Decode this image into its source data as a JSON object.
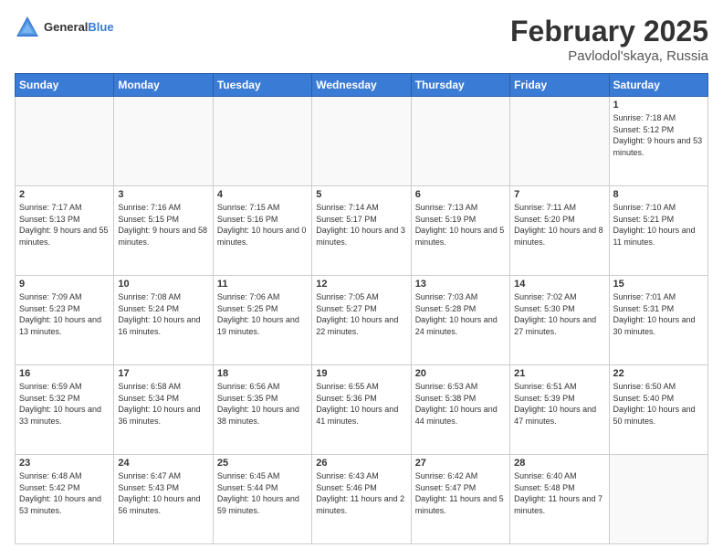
{
  "header": {
    "logo_general": "General",
    "logo_blue": "Blue",
    "month_title": "February 2025",
    "location": "Pavlodol'skaya, Russia"
  },
  "weekdays": [
    "Sunday",
    "Monday",
    "Tuesday",
    "Wednesday",
    "Thursday",
    "Friday",
    "Saturday"
  ],
  "weeks": [
    [
      {
        "day": "",
        "info": ""
      },
      {
        "day": "",
        "info": ""
      },
      {
        "day": "",
        "info": ""
      },
      {
        "day": "",
        "info": ""
      },
      {
        "day": "",
        "info": ""
      },
      {
        "day": "",
        "info": ""
      },
      {
        "day": "1",
        "info": "Sunrise: 7:18 AM\nSunset: 5:12 PM\nDaylight: 9 hours and 53 minutes."
      }
    ],
    [
      {
        "day": "2",
        "info": "Sunrise: 7:17 AM\nSunset: 5:13 PM\nDaylight: 9 hours and 55 minutes."
      },
      {
        "day": "3",
        "info": "Sunrise: 7:16 AM\nSunset: 5:15 PM\nDaylight: 9 hours and 58 minutes."
      },
      {
        "day": "4",
        "info": "Sunrise: 7:15 AM\nSunset: 5:16 PM\nDaylight: 10 hours and 0 minutes."
      },
      {
        "day": "5",
        "info": "Sunrise: 7:14 AM\nSunset: 5:17 PM\nDaylight: 10 hours and 3 minutes."
      },
      {
        "day": "6",
        "info": "Sunrise: 7:13 AM\nSunset: 5:19 PM\nDaylight: 10 hours and 5 minutes."
      },
      {
        "day": "7",
        "info": "Sunrise: 7:11 AM\nSunset: 5:20 PM\nDaylight: 10 hours and 8 minutes."
      },
      {
        "day": "8",
        "info": "Sunrise: 7:10 AM\nSunset: 5:21 PM\nDaylight: 10 hours and 11 minutes."
      }
    ],
    [
      {
        "day": "9",
        "info": "Sunrise: 7:09 AM\nSunset: 5:23 PM\nDaylight: 10 hours and 13 minutes."
      },
      {
        "day": "10",
        "info": "Sunrise: 7:08 AM\nSunset: 5:24 PM\nDaylight: 10 hours and 16 minutes."
      },
      {
        "day": "11",
        "info": "Sunrise: 7:06 AM\nSunset: 5:25 PM\nDaylight: 10 hours and 19 minutes."
      },
      {
        "day": "12",
        "info": "Sunrise: 7:05 AM\nSunset: 5:27 PM\nDaylight: 10 hours and 22 minutes."
      },
      {
        "day": "13",
        "info": "Sunrise: 7:03 AM\nSunset: 5:28 PM\nDaylight: 10 hours and 24 minutes."
      },
      {
        "day": "14",
        "info": "Sunrise: 7:02 AM\nSunset: 5:30 PM\nDaylight: 10 hours and 27 minutes."
      },
      {
        "day": "15",
        "info": "Sunrise: 7:01 AM\nSunset: 5:31 PM\nDaylight: 10 hours and 30 minutes."
      }
    ],
    [
      {
        "day": "16",
        "info": "Sunrise: 6:59 AM\nSunset: 5:32 PM\nDaylight: 10 hours and 33 minutes."
      },
      {
        "day": "17",
        "info": "Sunrise: 6:58 AM\nSunset: 5:34 PM\nDaylight: 10 hours and 36 minutes."
      },
      {
        "day": "18",
        "info": "Sunrise: 6:56 AM\nSunset: 5:35 PM\nDaylight: 10 hours and 38 minutes."
      },
      {
        "day": "19",
        "info": "Sunrise: 6:55 AM\nSunset: 5:36 PM\nDaylight: 10 hours and 41 minutes."
      },
      {
        "day": "20",
        "info": "Sunrise: 6:53 AM\nSunset: 5:38 PM\nDaylight: 10 hours and 44 minutes."
      },
      {
        "day": "21",
        "info": "Sunrise: 6:51 AM\nSunset: 5:39 PM\nDaylight: 10 hours and 47 minutes."
      },
      {
        "day": "22",
        "info": "Sunrise: 6:50 AM\nSunset: 5:40 PM\nDaylight: 10 hours and 50 minutes."
      }
    ],
    [
      {
        "day": "23",
        "info": "Sunrise: 6:48 AM\nSunset: 5:42 PM\nDaylight: 10 hours and 53 minutes."
      },
      {
        "day": "24",
        "info": "Sunrise: 6:47 AM\nSunset: 5:43 PM\nDaylight: 10 hours and 56 minutes."
      },
      {
        "day": "25",
        "info": "Sunrise: 6:45 AM\nSunset: 5:44 PM\nDaylight: 10 hours and 59 minutes."
      },
      {
        "day": "26",
        "info": "Sunrise: 6:43 AM\nSunset: 5:46 PM\nDaylight: 11 hours and 2 minutes."
      },
      {
        "day": "27",
        "info": "Sunrise: 6:42 AM\nSunset: 5:47 PM\nDaylight: 11 hours and 5 minutes."
      },
      {
        "day": "28",
        "info": "Sunrise: 6:40 AM\nSunset: 5:48 PM\nDaylight: 11 hours and 7 minutes."
      },
      {
        "day": "",
        "info": ""
      }
    ]
  ]
}
